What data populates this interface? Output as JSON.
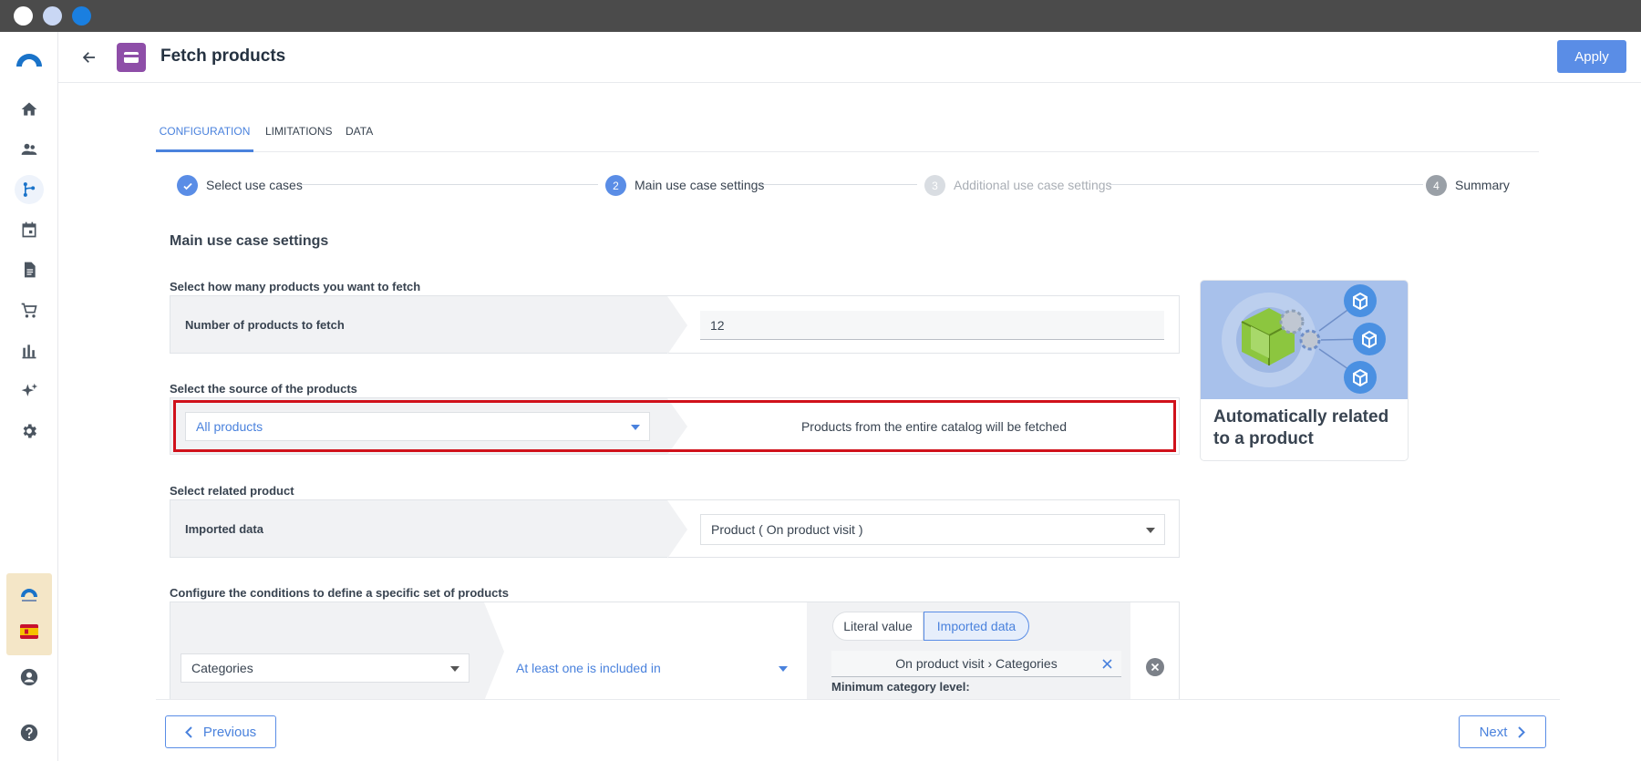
{
  "window": {
    "controls": [
      "close",
      "minimize",
      "maximize"
    ]
  },
  "sidebar": {
    "items": [
      {
        "icon": "logo-icon"
      },
      {
        "icon": "home-icon"
      },
      {
        "icon": "people-icon"
      },
      {
        "icon": "workflow-icon"
      },
      {
        "icon": "calendar-icon"
      },
      {
        "icon": "document-icon"
      },
      {
        "icon": "cart-icon"
      },
      {
        "icon": "bar-chart-icon"
      },
      {
        "icon": "sparkle-icon"
      },
      {
        "icon": "gear-icon"
      },
      {
        "icon": "account-icon"
      },
      {
        "icon": "help-icon"
      }
    ]
  },
  "header": {
    "title": "Fetch products",
    "apply_label": "Apply"
  },
  "tabs": [
    {
      "label": "CONFIGURATION",
      "active": true
    },
    {
      "label": "LIMITATIONS",
      "active": false
    },
    {
      "label": "DATA",
      "active": false
    }
  ],
  "stepper": {
    "steps": [
      {
        "number": "✓",
        "label": "Select use cases",
        "state": "done"
      },
      {
        "number": "2",
        "label": "Main use case settings",
        "state": "active"
      },
      {
        "number": "3",
        "label": "Additional use case settings",
        "state": "disabled"
      },
      {
        "number": "4",
        "label": "Summary",
        "state": "pending"
      }
    ]
  },
  "main": {
    "section_title": "Main use case settings",
    "count_section": {
      "label": "Select how many products you want to fetch",
      "row_label": "Number of products to fetch",
      "value": "12"
    },
    "source_section": {
      "label": "Select the source of the products",
      "selected": "All products",
      "description": "Products from the entire catalog will be fetched"
    },
    "related_section": {
      "label": "Select related product",
      "row_label": "Imported data",
      "selected": "Product ( On product visit )"
    },
    "conditions_section": {
      "label": "Configure the conditions to define a specific set of products",
      "attribute": "Categories",
      "operator": "At least one is included in",
      "toggle_literal": "Literal value",
      "toggle_imported": "Imported data",
      "value": "On product visit › Categories",
      "min_level_label": "Minimum category level:"
    }
  },
  "card": {
    "title": "Automatically related to a product"
  },
  "footer": {
    "previous_label": "Previous",
    "next_label": "Next"
  },
  "colors": {
    "accent": "#4a82dd",
    "highlight": "#d0111b",
    "node_badge": "#8e4ea8"
  }
}
